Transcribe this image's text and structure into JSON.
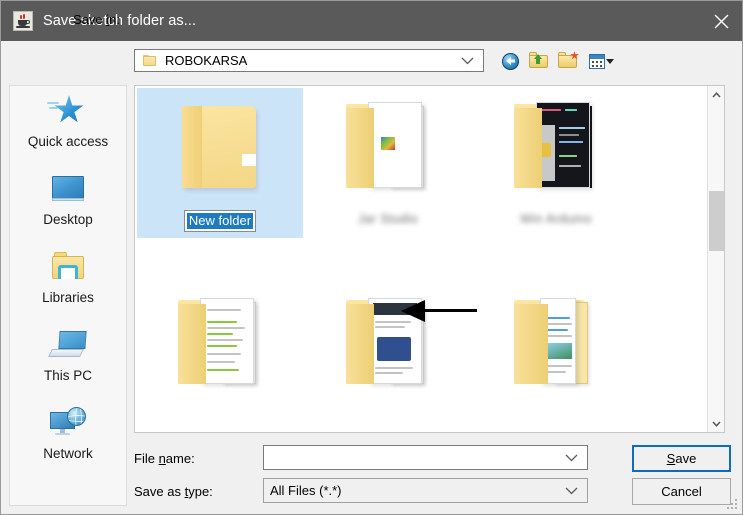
{
  "window": {
    "title": "Save sketch folder as...",
    "title_icon": "java-coffee-cup-icon",
    "close_label": "close-icon"
  },
  "lookin": {
    "label_pre": "Save ",
    "label_underlined": "i",
    "label_post": "n:",
    "value": "ROBOKARSA",
    "folder_icon": "folder-icon",
    "chevron_icon": "chevron-down-icon"
  },
  "toolbar": {
    "buttons": [
      {
        "name": "back-button",
        "icon": "back-arrow-icon",
        "tooltip": "Back"
      },
      {
        "name": "up-one-level-button",
        "icon": "up-folder-icon",
        "tooltip": "Up One Level"
      },
      {
        "name": "new-folder-button",
        "icon": "new-folder-icon",
        "tooltip": "Create New Folder"
      },
      {
        "name": "view-menu-button",
        "icon": "views-grid-icon",
        "tooltip": "View Menu"
      }
    ]
  },
  "places": {
    "items": [
      {
        "label": "Quick access",
        "icon": "star-icon"
      },
      {
        "label": "Desktop",
        "icon": "monitor-icon"
      },
      {
        "label": "Libraries",
        "icon": "libraries-folder-icon"
      },
      {
        "label": "This PC",
        "icon": "computer-icon"
      },
      {
        "label": "Network",
        "icon": "network-globe-icon"
      }
    ]
  },
  "filelist": {
    "items": [
      {
        "label": "New folder",
        "label_state": "editing-selected",
        "icon": "empty-folder-icon",
        "selected": true,
        "blurred": false
      },
      {
        "label": "",
        "label_state": "blurred",
        "icon": "folder-with-image-icon",
        "selected": false,
        "blurred": true
      },
      {
        "label": "",
        "label_state": "blurred",
        "icon": "folder-with-code-screenshots-icon",
        "selected": false,
        "blurred": true
      },
      {
        "label": "",
        "label_state": "hidden",
        "icon": "folder-with-documents-icon",
        "selected": false,
        "blurred": true
      },
      {
        "label": "",
        "label_state": "hidden",
        "icon": "folder-with-pages-icon",
        "selected": false,
        "blurred": true
      },
      {
        "label": "",
        "label_state": "hidden",
        "icon": "folder-with-report-icon",
        "selected": false,
        "blurred": true
      }
    ],
    "rename_editor": {
      "value": "New folder",
      "selected": true
    },
    "annotation": {
      "type": "left-pointing-arrow",
      "color": "#000000"
    },
    "scrollbar": {
      "up_icon": "chevron-up-icon",
      "down_icon": "chevron-down-icon",
      "thumb_position_pct": 30
    }
  },
  "form": {
    "filename_label_pre": "File ",
    "filename_label_underlined": "n",
    "filename_label_post": "ame:",
    "filename_value": "",
    "filename_placeholder": "",
    "savetype_label_pre": "Save as ",
    "savetype_label_underlined": "t",
    "savetype_label_post": "ype:",
    "savetype_value": "All Files (*.*)",
    "savetype_options": [
      "All Files (*.*)"
    ]
  },
  "buttons": {
    "save_pre": "",
    "save_underlined": "S",
    "save_post": "ave",
    "save_label": "Save",
    "cancel_label": "Cancel"
  },
  "colors": {
    "titlebar": "#5a5a5a",
    "dialog_face": "#f0f0f0",
    "selection": "#cce4f7",
    "text_selection": "#1f7ac4",
    "default_button_border": "#0f6cbd",
    "folder_yellow": "#f7dd93"
  }
}
